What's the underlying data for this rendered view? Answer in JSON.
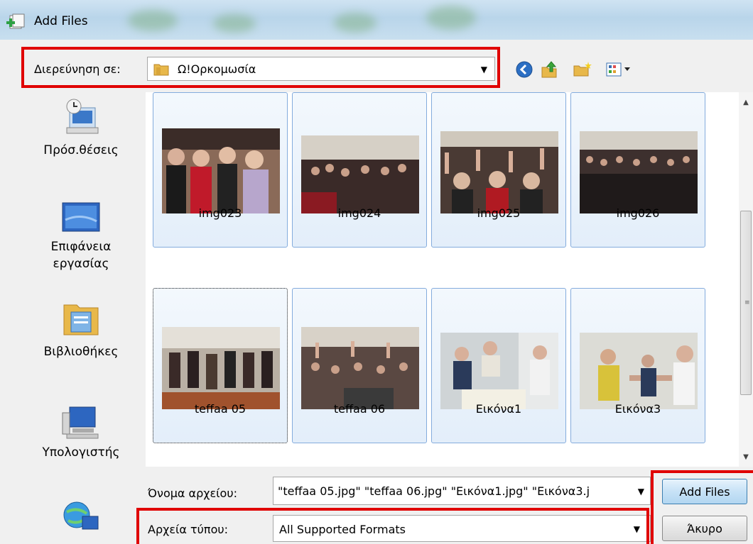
{
  "window": {
    "title": "Add Files"
  },
  "toolbar": {
    "lookin_label": "Διερεύνηση σε:",
    "lookin_value": "Ω!Ορκομωσία"
  },
  "places": [
    {
      "label": "Πρόσ.θέσεις",
      "icon": "recent-places-icon"
    },
    {
      "label": "Επιφάνεια εργασίας",
      "icon": "desktop-icon"
    },
    {
      "label": "Βιβλιοθήκες",
      "icon": "libraries-icon"
    },
    {
      "label": "Υπολογιστής",
      "icon": "computer-icon"
    },
    {
      "label": "",
      "icon": "network-icon"
    }
  ],
  "files": [
    {
      "name": "img023"
    },
    {
      "name": "img024"
    },
    {
      "name": "img025"
    },
    {
      "name": "img026"
    },
    {
      "name": "teffaa 05"
    },
    {
      "name": "teffaa 06"
    },
    {
      "name": "Εικόνα1"
    },
    {
      "name": "Εικόνα3"
    }
  ],
  "form": {
    "filename_label": "Όνομα αρχείου:",
    "filename_value": "\"teffaa 05.jpg\" \"teffaa 06.jpg\" \"Εικόνα1.jpg\" \"Εικόνα3.j",
    "filetype_label": "Αρχεία τύπου:",
    "filetype_value": "All Supported Formats",
    "add_label": "Add Files",
    "cancel_label": "Άκυρο"
  },
  "colors": {
    "highlight": "#e00000",
    "tile_border": "#84acdd",
    "primary_button": "#c7e2f6"
  }
}
